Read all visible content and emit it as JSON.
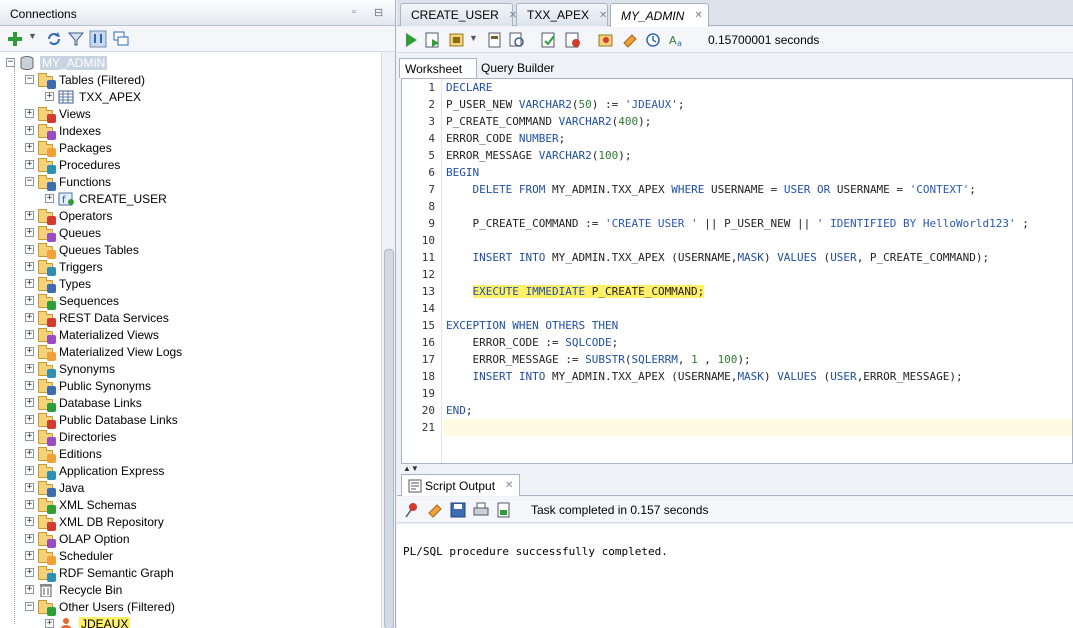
{
  "connections_panel": {
    "title": "Connections",
    "root": "MY_ADMIN",
    "items": [
      {
        "label": "Tables (Filtered)",
        "icon": "tables-folder-icon",
        "level": 1,
        "expanded": true
      },
      {
        "label": "TXX_APEX",
        "icon": "table-icon",
        "level": 2
      },
      {
        "label": "Views",
        "icon": "views-folder-icon",
        "level": 1
      },
      {
        "label": "Indexes",
        "icon": "indexes-folder-icon",
        "level": 1
      },
      {
        "label": "Packages",
        "icon": "packages-folder-icon",
        "level": 1
      },
      {
        "label": "Procedures",
        "icon": "procedures-folder-icon",
        "level": 1
      },
      {
        "label": "Functions",
        "icon": "functions-folder-icon",
        "level": 1,
        "expanded": true
      },
      {
        "label": "CREATE_USER",
        "icon": "function-icon",
        "level": 2
      },
      {
        "label": "Operators",
        "icon": "operators-folder-icon",
        "level": 1
      },
      {
        "label": "Queues",
        "icon": "queues-folder-icon",
        "level": 1
      },
      {
        "label": "Queues Tables",
        "icon": "queues-tables-folder-icon",
        "level": 1
      },
      {
        "label": "Triggers",
        "icon": "triggers-folder-icon",
        "level": 1
      },
      {
        "label": "Types",
        "icon": "types-folder-icon",
        "level": 1
      },
      {
        "label": "Sequences",
        "icon": "sequences-folder-icon",
        "level": 1
      },
      {
        "label": "REST Data Services",
        "icon": "rest-folder-icon",
        "level": 1
      },
      {
        "label": "Materialized Views",
        "icon": "mviews-folder-icon",
        "level": 1
      },
      {
        "label": "Materialized View Logs",
        "icon": "mview-logs-folder-icon",
        "level": 1
      },
      {
        "label": "Synonyms",
        "icon": "synonyms-folder-icon",
        "level": 1
      },
      {
        "label": "Public Synonyms",
        "icon": "public-synonyms-folder-icon",
        "level": 1
      },
      {
        "label": "Database Links",
        "icon": "db-links-folder-icon",
        "level": 1
      },
      {
        "label": "Public Database Links",
        "icon": "public-db-links-folder-icon",
        "level": 1
      },
      {
        "label": "Directories",
        "icon": "directories-folder-icon",
        "level": 1
      },
      {
        "label": "Editions",
        "icon": "editions-folder-icon",
        "level": 1
      },
      {
        "label": "Application Express",
        "icon": "apex-folder-icon",
        "level": 1
      },
      {
        "label": "Java",
        "icon": "java-folder-icon",
        "level": 1
      },
      {
        "label": "XML Schemas",
        "icon": "xml-schemas-folder-icon",
        "level": 1
      },
      {
        "label": "XML DB Repository",
        "icon": "xml-db-folder-icon",
        "level": 1
      },
      {
        "label": "OLAP Option",
        "icon": "olap-folder-icon",
        "level": 1
      },
      {
        "label": "Scheduler",
        "icon": "scheduler-folder-icon",
        "level": 1
      },
      {
        "label": "RDF Semantic Graph",
        "icon": "rdf-folder-icon",
        "level": 1
      },
      {
        "label": "Recycle Bin",
        "icon": "recycle-bin-icon",
        "level": 1
      },
      {
        "label": "Other Users (Filtered)",
        "icon": "other-users-folder-icon",
        "level": 1,
        "expanded": true
      },
      {
        "label": "JDEAUX",
        "icon": "user-icon",
        "level": 2,
        "highlighted": true
      }
    ]
  },
  "editor": {
    "tabs": [
      {
        "label": "CREATE_USER",
        "icon": "function-icon"
      },
      {
        "label": "TXX_APEX",
        "icon": "table-icon"
      },
      {
        "label": "MY_ADMIN",
        "icon": "sql-worksheet-icon",
        "active": true
      }
    ],
    "elapsed": "0.15700001 seconds",
    "subtabs": [
      "Worksheet",
      "Query Builder"
    ],
    "lines": [
      "DECLARE",
      "P_USER_NEW VARCHAR2(50) := 'JDEAUX';",
      "P_CREATE_COMMAND VARCHAR2(400);",
      "ERROR_CODE NUMBER;",
      "ERROR_MESSAGE VARCHAR2(100);",
      "BEGIN",
      "    DELETE FROM MY_ADMIN.TXX_APEX WHERE USERNAME = USER OR USERNAME = 'CONTEXT';",
      "",
      "    P_CREATE_COMMAND := 'CREATE USER ' || P_USER_NEW || ' IDENTIFIED BY HelloWorld123' ;",
      "",
      "    INSERT INTO MY_ADMIN.TXX_APEX (USERNAME,MASK) VALUES (USER, P_CREATE_COMMAND);",
      "",
      "    EXECUTE IMMEDIATE P_CREATE_COMMAND;",
      "",
      "EXCEPTION WHEN OTHERS THEN",
      "    ERROR_CODE := SQLCODE;",
      "    ERROR_MESSAGE := SUBSTR(SQLERRM, 1 , 100);",
      "    INSERT INTO MY_ADMIN.TXX_APEX (USERNAME,MASK) VALUES (USER,ERROR_MESSAGE);",
      "",
      "END;",
      ""
    ],
    "highlighted_line": 13
  },
  "script_output": {
    "tab_label": "Script Output",
    "status": "Task completed in 0.157 seconds",
    "message": "PL/SQL procedure successfully completed."
  }
}
